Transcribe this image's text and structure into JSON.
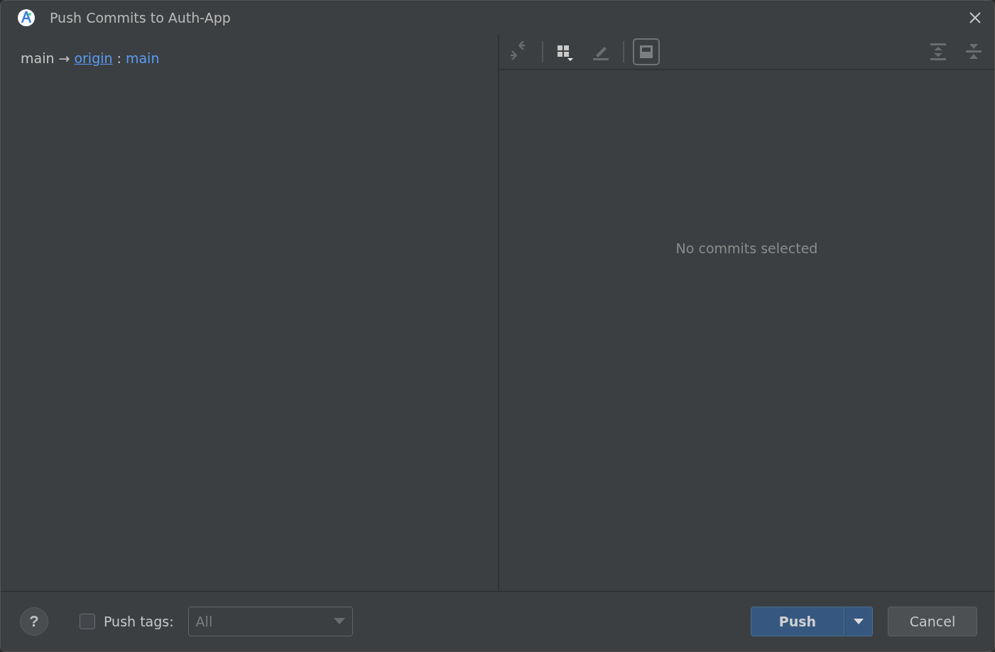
{
  "window": {
    "title": "Push Commits to Auth-App"
  },
  "branch": {
    "local": "main",
    "arrow": "→",
    "remote": "origin",
    "separator": ":",
    "target": "main"
  },
  "toolbar": {
    "left": [
      {
        "kind": "arrows",
        "selected": false
      },
      {
        "kind": "separator"
      },
      {
        "kind": "grid",
        "selected": false
      },
      {
        "kind": "pencil",
        "selected": false
      },
      {
        "kind": "separator"
      },
      {
        "kind": "preview",
        "selected": true
      }
    ],
    "right": [
      {
        "kind": "expand",
        "selected": false
      },
      {
        "kind": "collapse",
        "selected": false
      }
    ]
  },
  "details": {
    "empty_text": "No commits selected"
  },
  "footer": {
    "help": "?",
    "push_tags": {
      "label": "Push tags:",
      "checked": false
    },
    "tags_select": {
      "value": "All",
      "disabled": true
    },
    "push_button": "Push",
    "cancel_button": "Cancel"
  }
}
